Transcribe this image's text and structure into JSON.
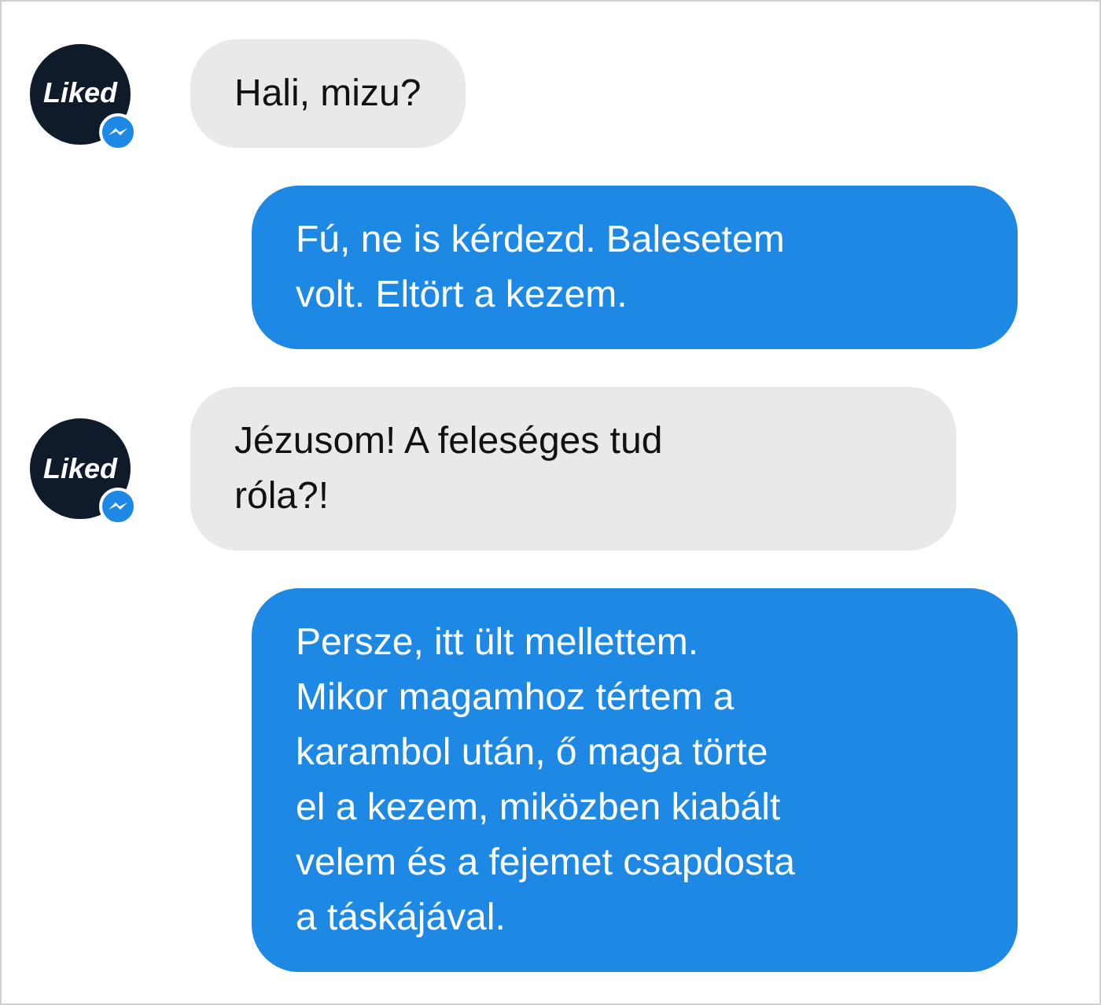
{
  "messages": [
    {
      "kind": "incoming",
      "avatar": "Liked",
      "text": "Hali, mizu?"
    },
    {
      "kind": "outgoing",
      "text": "Fú, ne is kérdezd. Balesetem\nvolt. Eltört a kezem."
    },
    {
      "kind": "incoming",
      "avatar": "Liked",
      "text": "Jézusom! A feleséges tud\nróla?!"
    },
    {
      "kind": "outgoing",
      "text": "Persze, itt ült mellettem.\nMikor magamhoz tértem a\nkarambol után, ő maga törte\nel a kezem, miközben kiabált\nvelem és a fejemet csapdosta\na táskájával."
    }
  ]
}
